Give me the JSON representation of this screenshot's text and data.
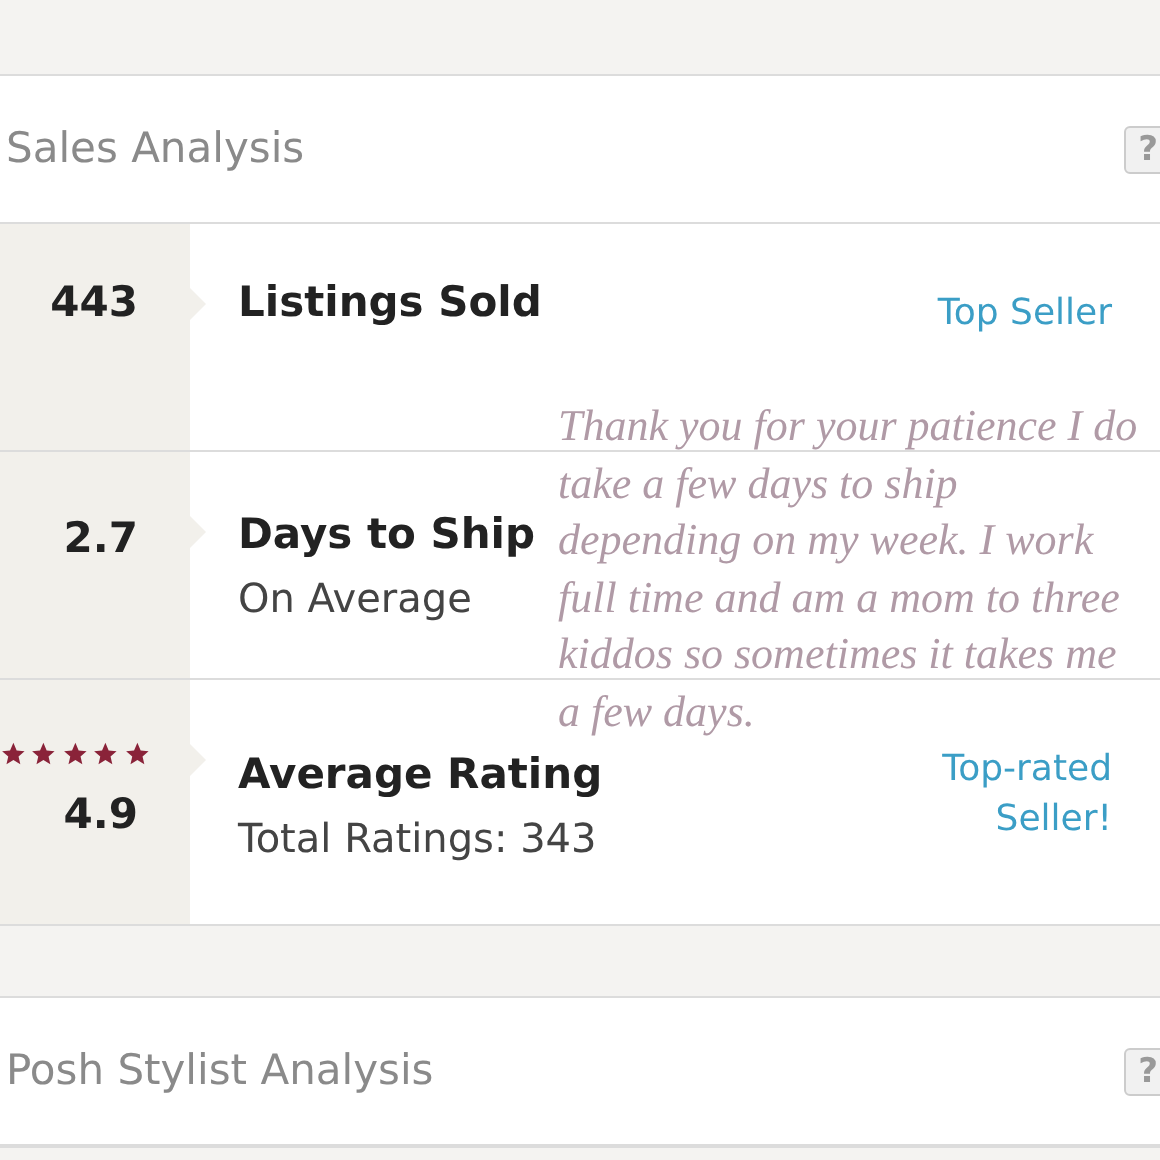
{
  "sections": [
    {
      "title": "Sales Analysis",
      "help": "?",
      "rows": [
        {
          "kind": "count",
          "value": "443",
          "label": "Listings Sold",
          "badge": "Top Seller"
        },
        {
          "kind": "average",
          "value": "2.7",
          "label": "Days to Ship",
          "sublabel": "On Average"
        },
        {
          "kind": "rating",
          "stars": 5,
          "value": "4.9",
          "label": "Average Rating",
          "sublabel": "Total Ratings: 343",
          "badge": "Top-rated Seller!"
        }
      ]
    },
    {
      "title": "Posh Stylist Analysis",
      "help": "?"
    }
  ],
  "note": "Thank you for your patience I do take a few days to ship depending on my week. I work full time and am a mom to three kiddos so sometimes it takes me a few days."
}
